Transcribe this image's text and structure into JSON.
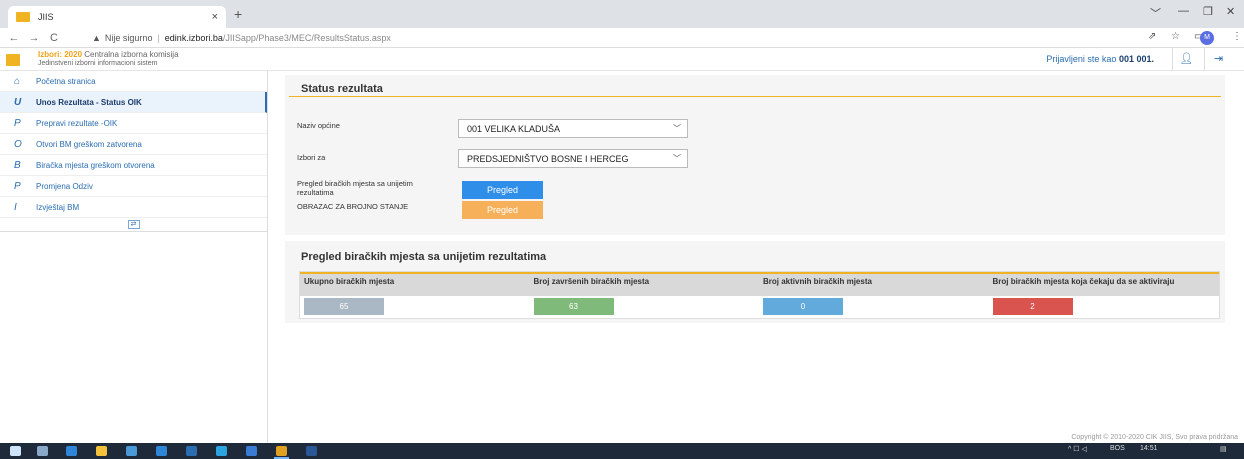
{
  "browser": {
    "tab_title": "JIIS",
    "tab_close": "×",
    "new_tab": "+",
    "url_security": "Nije sigurno",
    "url_host": "edink.izbori.ba",
    "url_path": "/JIISapp/Phase3/MEC/ResultsStatus.aspx",
    "profile_initial": "M"
  },
  "header": {
    "brand_year_label": "Izbori: 2020",
    "brand_org": "Centralna izborna komisija",
    "brand_sub": "Jedinstveni izborni informacioni sistem",
    "logged_in_prefix": "Prijavljeni ste kao",
    "logged_in_user": "001 001."
  },
  "sidebar": {
    "home_label": "Početna stranica",
    "items": [
      {
        "icon": "U",
        "label": "Unos Rezultata - Status OIK"
      },
      {
        "icon": "P",
        "label": "Prepravi rezultate -OIK"
      },
      {
        "icon": "O",
        "label": "Otvori BM greškom zatvorena"
      },
      {
        "icon": "B",
        "label": "Biračka mjesta greškom otvorena"
      },
      {
        "icon": "P",
        "label": "Promjena Odziv"
      },
      {
        "icon": "I",
        "label": "Izvještaj BM"
      }
    ],
    "collapse_glyph": "⇄"
  },
  "status_panel": {
    "title": "Status rezultata",
    "municipality_label": "Naziv općine",
    "municipality_value": "001 VELIKA KLADUŠA",
    "election_label": "Izbori za",
    "election_value": "PREDSJEDNIŠTVO BOSNE I HERCEG",
    "review_label": "Pregled biračkih mjesta sa unijetim rezultatima",
    "review_button": "Pregled",
    "form_label": "OBRAZAC ZA BROJNO STANJE",
    "form_button": "Pregled"
  },
  "summary": {
    "title": "Pregled biračkih mjesta sa unijetim rezultatima",
    "headers": [
      "Ukupno biračkih mjesta",
      "Broj završenih biračkih mjesta",
      "Broj aktivnih biračkih mjesta",
      "Broj biračkih mjesta koja čekaju da se aktiviraju"
    ],
    "values": [
      "65",
      "63",
      "0",
      "2"
    ],
    "colors": [
      "#a9b8c4",
      "#7fba7a",
      "#62a9dc",
      "#d9534f"
    ]
  },
  "footer": {
    "copyright": "Copyright © 2010-2020 CIK JIIS, Svo prava pridržana"
  },
  "taskbar": {
    "language": "BOS",
    "time": "14:51"
  }
}
